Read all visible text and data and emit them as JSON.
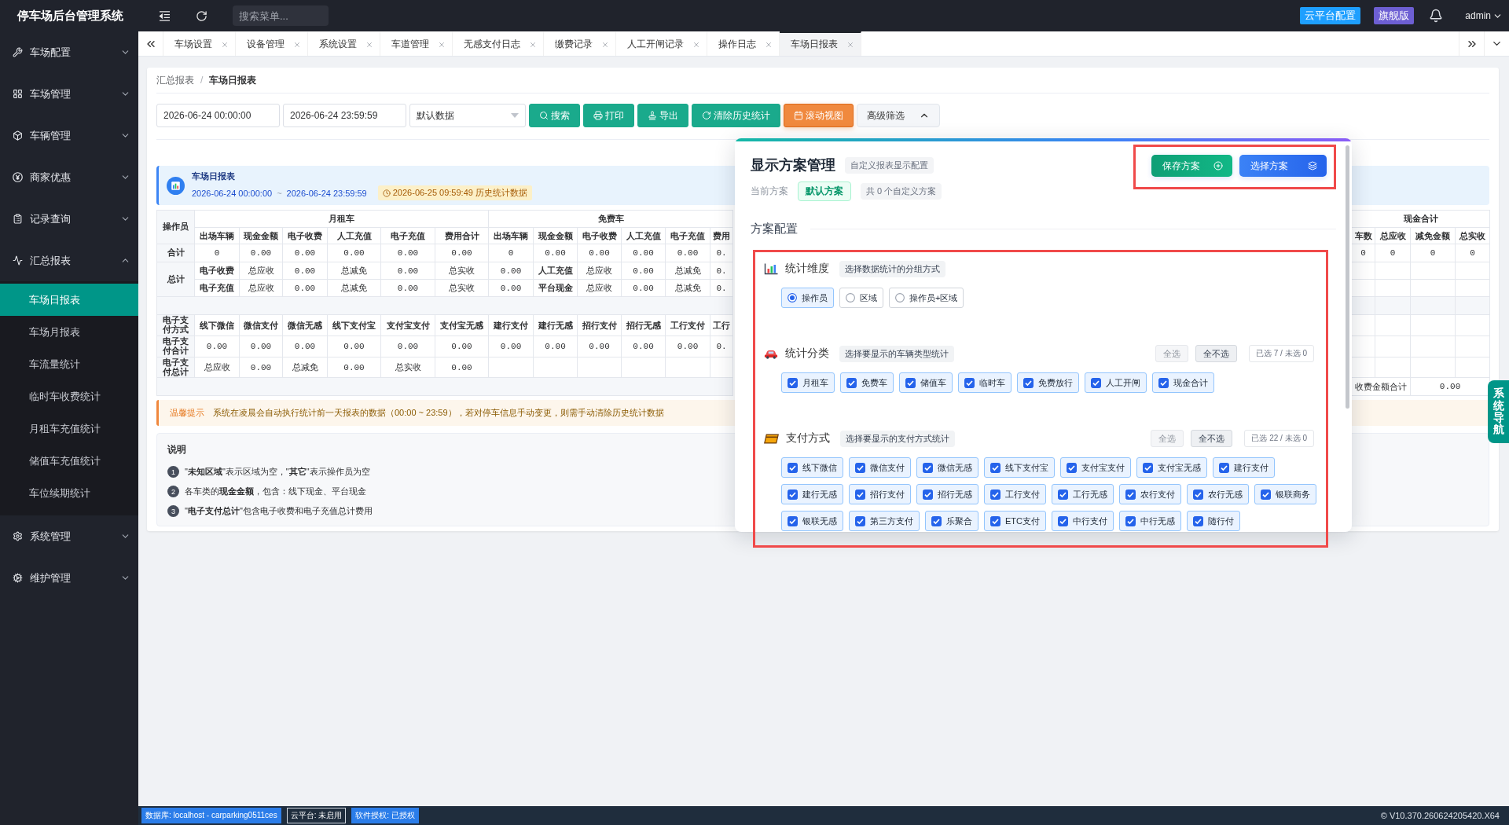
{
  "app": {
    "title": "停车场后台管理系统"
  },
  "top_bar": {
    "search": {
      "placeholder": "搜索菜单..."
    },
    "badges": [
      {
        "label": "云平台配置",
        "color": "#1e9fff"
      },
      {
        "label": "旗舰版",
        "color": "#6d5fd3"
      }
    ],
    "user": "admin"
  },
  "sidebar": {
    "items": [
      {
        "label": "车场配置",
        "expanded": false
      },
      {
        "label": "车场管理",
        "expanded": false
      },
      {
        "label": "车辆管理",
        "expanded": false
      },
      {
        "label": "商家优惠",
        "expanded": false
      },
      {
        "label": "记录查询",
        "expanded": false
      },
      {
        "label": "汇总报表",
        "expanded": true,
        "children": [
          {
            "label": "车场日报表",
            "selected": true
          },
          {
            "label": "车场月报表",
            "selected": false
          },
          {
            "label": "车流量统计",
            "selected": false
          },
          {
            "label": "临时车收费统计",
            "selected": false
          },
          {
            "label": "月租车充值统计",
            "selected": false
          },
          {
            "label": "储值车充值统计",
            "selected": false
          },
          {
            "label": "车位续期统计",
            "selected": false
          }
        ]
      },
      {
        "label": "系统管理",
        "expanded": false
      },
      {
        "label": "维护管理",
        "expanded": false
      }
    ]
  },
  "tabs": [
    {
      "label": "车场设置",
      "selected": false
    },
    {
      "label": "设备管理",
      "selected": false
    },
    {
      "label": "系统设置",
      "selected": false
    },
    {
      "label": "车道管理",
      "selected": false
    },
    {
      "label": "无感支付日志",
      "selected": false
    },
    {
      "label": "缴费记录",
      "selected": false
    },
    {
      "label": "人工开闸记录",
      "selected": false
    },
    {
      "label": "操作日志",
      "selected": false
    },
    {
      "label": "车场日报表",
      "selected": true
    }
  ],
  "breadcrumb": {
    "items": [
      "汇总报表",
      "车场日报表"
    ],
    "separator": "/"
  },
  "filters": {
    "start_time": "2026-06-24 00:00:00",
    "end_time": "2026-06-24 23:59:59",
    "data_source": "默认数据"
  },
  "toolbar_buttons": [
    {
      "label": "搜索",
      "kind": "primary"
    },
    {
      "label": "打印",
      "kind": "primary"
    },
    {
      "label": "导出",
      "kind": "primary"
    },
    {
      "label": "清除历史统计",
      "kind": "primary"
    },
    {
      "label": "滚动视图",
      "kind": "warning"
    }
  ],
  "advanced_filter": {
    "label": "高级筛选",
    "expanded": true
  },
  "report_banner": {
    "title": "车场日报表",
    "start_time": "2026-06-24 00:00:00",
    "separator": "~",
    "end_time": "2026-06-24 23:59:59",
    "stamp": "2026-06-25 09:59:49 历史统计数据"
  },
  "report_table": {
    "corner": "操作员",
    "groups": [
      {
        "label": "月租车",
        "columns": [
          "出场车辆",
          "现金金额",
          "电子收费",
          "人工充值",
          "电子充值",
          "费用合计"
        ]
      },
      {
        "label": "免费车",
        "columns": [
          "出场车辆",
          "现金金额",
          "电子收费",
          "人工充值",
          "电子充值",
          "费用"
        ]
      }
    ],
    "cash_group": {
      "label": "现金合计",
      "columns": [
        "车数",
        "总应收",
        "减免金额",
        "总实收"
      ]
    },
    "total_row": {
      "label": "合计",
      "values": [
        "0",
        "0.00",
        "0.00",
        "0.00",
        "0.00",
        "0.00",
        "0",
        "0.00",
        "0.00",
        "0.00",
        "0.00",
        "0."
      ],
      "cash_values": [
        "0",
        "0",
        "0",
        "0"
      ]
    },
    "summary": {
      "label": "总计",
      "rows": [
        [
          {
            "text": "电子收费",
            "kind": "head"
          },
          {
            "text": "总应收",
            "kind": "value"
          },
          {
            "text": "0.00",
            "kind": "value"
          },
          {
            "text": "总减免",
            "kind": "value"
          },
          {
            "text": "0.00",
            "kind": "value"
          },
          {
            "text": "总实收",
            "kind": "value"
          },
          {
            "text": "0.00",
            "kind": "value"
          },
          {
            "text": "人工充值",
            "kind": "head"
          },
          {
            "text": "总应收",
            "kind": "value"
          },
          {
            "text": "0.00",
            "kind": "value"
          },
          {
            "text": "总减免",
            "kind": "value"
          },
          {
            "text": "0.",
            "kind": "value"
          }
        ],
        [
          {
            "text": "电子充值",
            "kind": "head"
          },
          {
            "text": "总应收",
            "kind": "value"
          },
          {
            "text": "0.00",
            "kind": "value"
          },
          {
            "text": "总减免",
            "kind": "value"
          },
          {
            "text": "0.00",
            "kind": "value"
          },
          {
            "text": "总实收",
            "kind": "value"
          },
          {
            "text": "0.00",
            "kind": "value"
          },
          {
            "text": "平台现金",
            "kind": "head"
          },
          {
            "text": "总应收",
            "kind": "value"
          },
          {
            "text": "0.00",
            "kind": "value"
          },
          {
            "text": "总减免",
            "kind": "value"
          },
          {
            "text": "0.",
            "kind": "value"
          }
        ]
      ]
    },
    "payment_header": {
      "label": "电子支付方式",
      "columns": [
        "线下微信",
        "微信支付",
        "微信无感",
        "线下支付宝",
        "支付宝支付",
        "支付宝无感",
        "建行支付",
        "建行无感",
        "招行支付",
        "招行无感",
        "工行支付",
        "工行"
      ]
    },
    "payment_total": {
      "label": "电子支付合计",
      "values": [
        "0.00",
        "0.00",
        "0.00",
        "0.00",
        "0.00",
        "0.00",
        "0.00",
        "0.00",
        "0.00",
        "0.00",
        "0.00",
        "0."
      ]
    },
    "payment_summary": {
      "label": "电子支付总计",
      "values": [
        "总应收",
        "0.00",
        "总减免",
        "0.00",
        "总实收",
        "0.00"
      ]
    },
    "fee_total": {
      "label": "收费金额合计",
      "value": "0.00"
    }
  },
  "warning": {
    "label": "温馨提示",
    "text": "系统在凌晨会自动执行统计前一天报表的数据（00:00 ~ 23:59），若对停车信息手动变更，则需手动清除历史统计数据"
  },
  "notes": {
    "title": "说明",
    "items": [
      {
        "number": "1",
        "text": "\"**未知区域**\"表示区域为空，\"**其它**\"表示操作员为空"
      },
      {
        "number": "2",
        "text": "各车类的**现金金额**，包含：线下现金、平台现金"
      },
      {
        "number": "3",
        "text": "\"**电子支付总计**\"包含电子收费和电子充值总计费用"
      }
    ]
  },
  "scheme_panel": {
    "title": "显示方案管理",
    "subtitle": "自定义报表显示配置",
    "current_label": "当前方案",
    "current_scheme": "默认方案",
    "custom_count": "共 0 个自定义方案",
    "actions": {
      "highlighted": true,
      "buttons": [
        {
          "label": "保存方案",
          "kind": "save"
        },
        {
          "label": "选择方案",
          "kind": "select"
        }
      ]
    },
    "config": {
      "title": "方案配置",
      "highlighted": true,
      "sections": [
        {
          "title": "统计维度",
          "hint": "选择数据统计的分组方式",
          "kind": "radio",
          "options": [
            {
              "label": "操作员",
              "selected": true
            },
            {
              "label": "区域",
              "selected": false
            },
            {
              "label": "操作员+区域",
              "selected": false
            }
          ]
        },
        {
          "title": "统计分类",
          "hint": "选择要显示的车辆类型统计",
          "kind": "checkbox",
          "bulk": [
            {
              "label": "全选",
              "disabled": true
            },
            {
              "label": "全不选",
              "disabled": false
            }
          ],
          "counter": "已选 7 / 未选 0",
          "options": [
            {
              "label": "月租车",
              "checked": true
            },
            {
              "label": "免费车",
              "checked": true
            },
            {
              "label": "储值车",
              "checked": true
            },
            {
              "label": "临时车",
              "checked": true
            },
            {
              "label": "免费放行",
              "checked": true
            },
            {
              "label": "人工开闸",
              "checked": true
            },
            {
              "label": "现金合计",
              "checked": true
            }
          ]
        },
        {
          "title": "支付方式",
          "hint": "选择要显示的支付方式统计",
          "kind": "checkbox",
          "bulk": [
            {
              "label": "全选",
              "disabled": true
            },
            {
              "label": "全不选",
              "disabled": false
            }
          ],
          "counter": "已选 22 / 未选 0",
          "options": [
            {
              "label": "线下微信",
              "checked": true
            },
            {
              "label": "微信支付",
              "checked": true
            },
            {
              "label": "微信无感",
              "checked": true
            },
            {
              "label": "线下支付宝",
              "checked": true
            },
            {
              "label": "支付宝支付",
              "checked": true
            },
            {
              "label": "支付宝无感",
              "checked": true
            },
            {
              "label": "建行支付",
              "checked": true
            },
            {
              "label": "建行无感",
              "checked": true
            },
            {
              "label": "招行支付",
              "checked": true
            },
            {
              "label": "招行无感",
              "checked": true
            },
            {
              "label": "工行支付",
              "checked": true
            },
            {
              "label": "工行无感",
              "checked": true
            },
            {
              "label": "农行支付",
              "checked": true
            },
            {
              "label": "农行无感",
              "checked": true
            },
            {
              "label": "银联商务",
              "checked": true
            },
            {
              "label": "银联无感",
              "checked": true
            },
            {
              "label": "第三方支付",
              "checked": true
            },
            {
              "label": "乐聚合",
              "checked": true
            },
            {
              "label": "ETC支付",
              "checked": true
            },
            {
              "label": "中行支付",
              "checked": true
            },
            {
              "label": "中行无感",
              "checked": true
            },
            {
              "label": "随行付",
              "checked": true
            }
          ]
        }
      ]
    }
  },
  "side_tab": {
    "label": "系统导航"
  },
  "status_bar": {
    "items": [
      {
        "label": "数据库: localhost - carparking0511ces",
        "kind": "filled"
      },
      {
        "label": "云平台: 未启用",
        "kind": "outline"
      },
      {
        "label": "软件授权: 已授权",
        "kind": "filled"
      }
    ],
    "version": "© V10.370.260624205420.X64"
  }
}
